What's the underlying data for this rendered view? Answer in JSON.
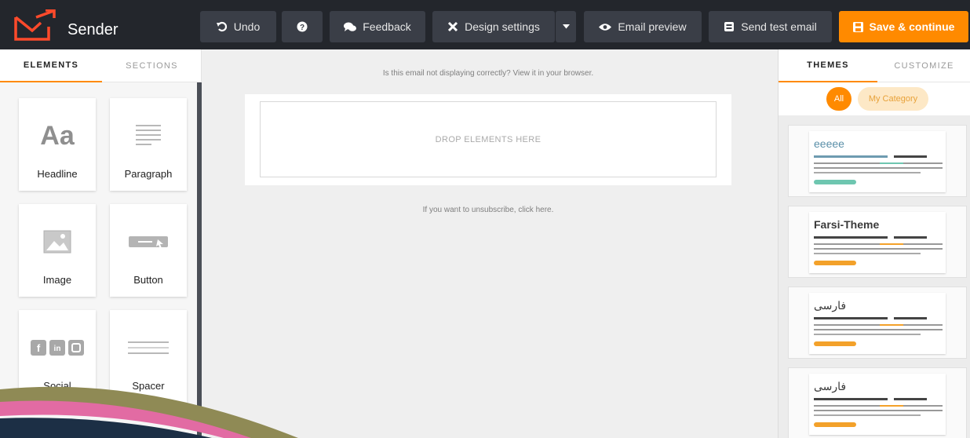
{
  "app": {
    "brand": "Sender"
  },
  "toolbar": {
    "undo_label": "Undo",
    "help_icon": "question-circle-icon",
    "feedback_label": "Feedback",
    "design_settings_label": "Design settings",
    "email_preview_label": "Email preview",
    "send_test_label": "Send test email",
    "save_label": "Save & continue"
  },
  "left_tabs": [
    "ELEMENTS",
    "SECTIONS"
  ],
  "elements": [
    {
      "label": "Headline",
      "icon": "headline-aa-icon",
      "glyph": "Aa"
    },
    {
      "label": "Paragraph",
      "icon": "paragraph-lines-icon"
    },
    {
      "label": "Image",
      "icon": "image-icon"
    },
    {
      "label": "Button",
      "icon": "button-icon"
    },
    {
      "label": "Social",
      "icon": "social-icons-icon"
    },
    {
      "label": "Spacer",
      "icon": "spacer-icon"
    }
  ],
  "canvas": {
    "view_in_browser": "Is this email not displaying correctly? View it in your browser.",
    "drop_hint": "DROP ELEMENTS HERE",
    "unsubscribe": "If you want to unsubscribe, click here."
  },
  "right_tabs": [
    "THEMES",
    "CUSTOMIZE"
  ],
  "theme_filters": [
    "All",
    "My Category"
  ],
  "themes": [
    {
      "title": "eeeee",
      "title_color": "#5a8fa8",
      "accent": "#6ec6b0",
      "bar": "#6ec6b0"
    },
    {
      "title": "Farsi-Theme",
      "title_color": "#3a3a3a",
      "accent": "#f3a12a",
      "bar": "#f3a12a"
    },
    {
      "title": "فارسی",
      "title_color": "#3a3a3a",
      "accent": "#f3a12a",
      "bar": "#f3a12a"
    },
    {
      "title": "فارسی",
      "title_color": "#3a3a3a",
      "accent": "#f3a12a",
      "bar": "#f3a12a"
    }
  ],
  "colors": {
    "accent": "#ff8a00",
    "topbar": "#23262c",
    "button": "#3a3e47"
  }
}
